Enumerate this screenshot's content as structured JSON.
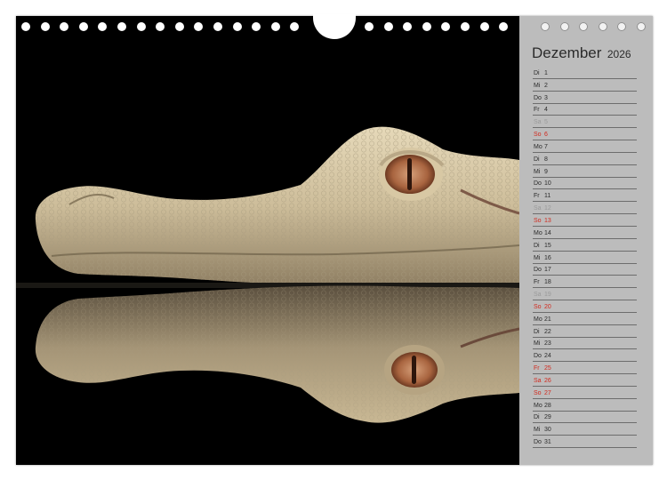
{
  "calendar": {
    "month": "Dezember",
    "year": "2026",
    "days": [
      {
        "wd": "Di",
        "d": "1",
        "type": "weekday"
      },
      {
        "wd": "Mi",
        "d": "2",
        "type": "weekday"
      },
      {
        "wd": "Do",
        "d": "3",
        "type": "weekday"
      },
      {
        "wd": "Fr",
        "d": "4",
        "type": "weekday"
      },
      {
        "wd": "Sa",
        "d": "5",
        "type": "sat"
      },
      {
        "wd": "So",
        "d": "6",
        "type": "sun"
      },
      {
        "wd": "Mo",
        "d": "7",
        "type": "weekday"
      },
      {
        "wd": "Di",
        "d": "8",
        "type": "weekday"
      },
      {
        "wd": "Mi",
        "d": "9",
        "type": "weekday"
      },
      {
        "wd": "Do",
        "d": "10",
        "type": "weekday"
      },
      {
        "wd": "Fr",
        "d": "11",
        "type": "weekday"
      },
      {
        "wd": "Sa",
        "d": "12",
        "type": "sat"
      },
      {
        "wd": "So",
        "d": "13",
        "type": "sun"
      },
      {
        "wd": "Mo",
        "d": "14",
        "type": "weekday"
      },
      {
        "wd": "Di",
        "d": "15",
        "type": "weekday"
      },
      {
        "wd": "Mi",
        "d": "16",
        "type": "weekday"
      },
      {
        "wd": "Do",
        "d": "17",
        "type": "weekday"
      },
      {
        "wd": "Fr",
        "d": "18",
        "type": "weekday"
      },
      {
        "wd": "Sa",
        "d": "19",
        "type": "sat"
      },
      {
        "wd": "So",
        "d": "20",
        "type": "sun"
      },
      {
        "wd": "Mo",
        "d": "21",
        "type": "weekday"
      },
      {
        "wd": "Di",
        "d": "22",
        "type": "weekday"
      },
      {
        "wd": "Mi",
        "d": "23",
        "type": "weekday"
      },
      {
        "wd": "Do",
        "d": "24",
        "type": "weekday"
      },
      {
        "wd": "Fr",
        "d": "25",
        "type": "holiday"
      },
      {
        "wd": "Sa",
        "d": "26",
        "type": "sun"
      },
      {
        "wd": "So",
        "d": "27",
        "type": "sun"
      },
      {
        "wd": "Mo",
        "d": "28",
        "type": "weekday"
      },
      {
        "wd": "Di",
        "d": "29",
        "type": "weekday"
      },
      {
        "wd": "Mi",
        "d": "30",
        "type": "weekday"
      },
      {
        "wd": "Do",
        "d": "31",
        "type": "weekday"
      }
    ]
  },
  "colors": {
    "background": "#bcbcbc",
    "text": "#2b2b2b",
    "sunday_holiday": "#d22a1e",
    "saturday": "#9a9a9a",
    "rule": "#6d6d6d",
    "photo_background": "#000000"
  },
  "photo": {
    "subject_icon": "crocodile-head-reflection-image"
  },
  "binding": {
    "icon": "wire-binding-holes",
    "hole_count_photo": 15,
    "hole_count_side": 6
  }
}
